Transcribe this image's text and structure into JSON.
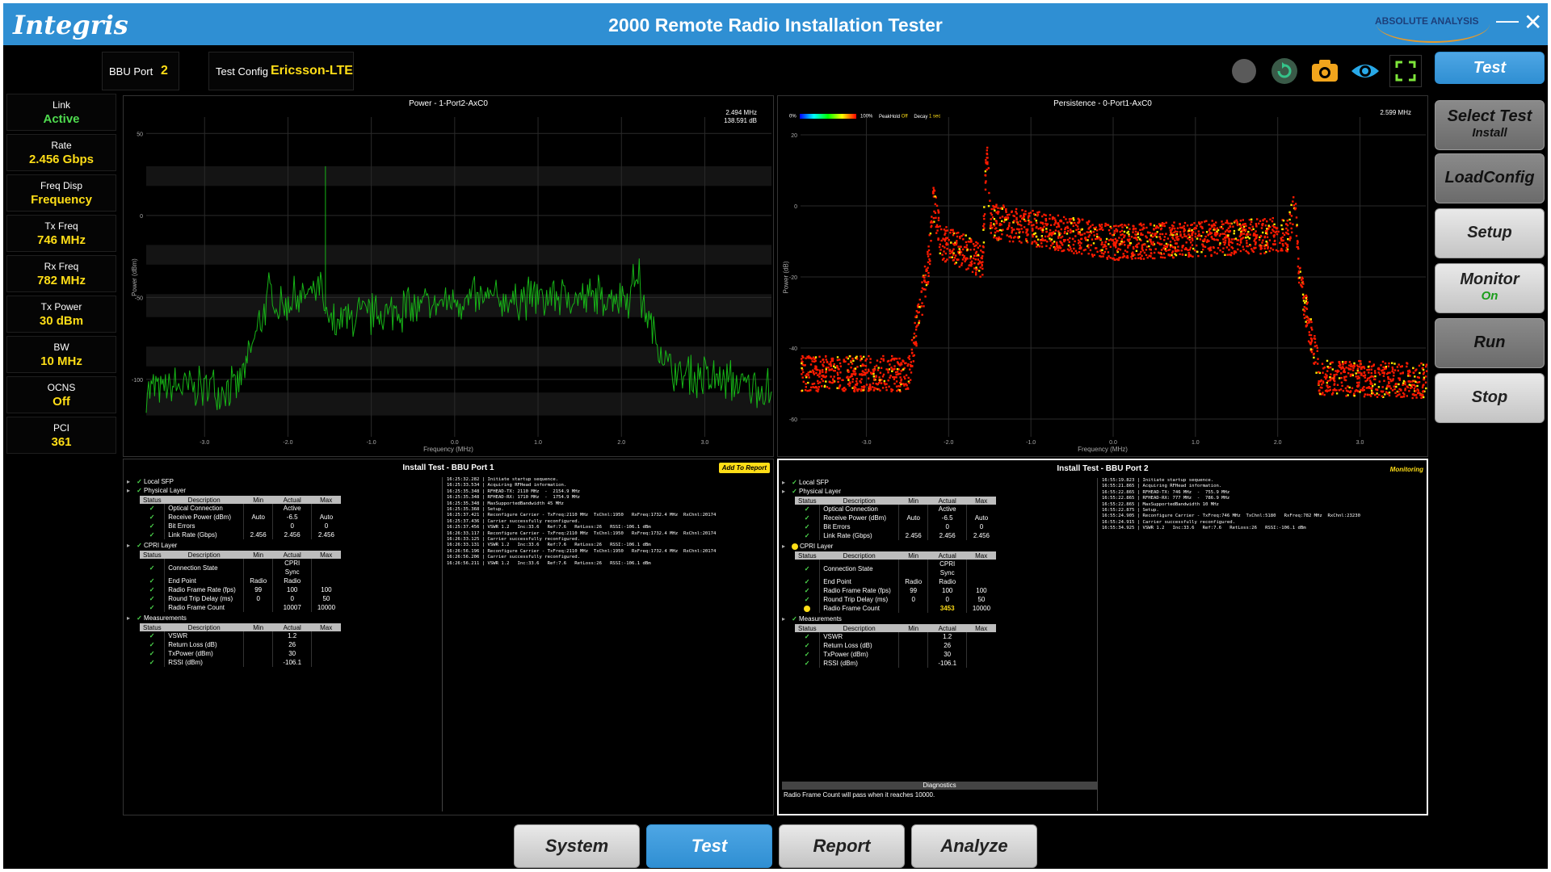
{
  "window": {
    "title": "2000 Remote Radio Installation Tester",
    "logo": "Integris",
    "brand": "ABSOLUTE ANALYSIS",
    "minimize_icon": "minimize-icon",
    "close_icon": "close-icon"
  },
  "toolbar": {
    "bbu_port_label": "BBU Port",
    "bbu_port_value": "2",
    "test_config_label": "Test Config",
    "test_config_value": "Ericsson-LTE",
    "icons": [
      "record-circle-icon",
      "refresh-icon",
      "camera-icon",
      "eye-icon",
      "fullscreen-icon"
    ]
  },
  "status": [
    {
      "label": "Link",
      "value": "Active",
      "color": "#4fdc4f"
    },
    {
      "label": "Rate",
      "value": "2.456 Gbps"
    },
    {
      "label": "Freq Disp",
      "value": "Frequency"
    },
    {
      "label": "Tx Freq",
      "value": "746 MHz"
    },
    {
      "label": "Rx Freq",
      "value": "782 MHz"
    },
    {
      "label": "Tx Power",
      "value": "30 dBm"
    },
    {
      "label": "BW",
      "value": "10 MHz"
    },
    {
      "label": "OCNS",
      "value": "Off"
    },
    {
      "label": "PCI",
      "value": "361"
    }
  ],
  "right_menu": [
    {
      "label": "Test",
      "state": "active"
    },
    {
      "label": "Select Test",
      "sub": "Install",
      "state": "dim"
    },
    {
      "label": "LoadConfig",
      "state": "dim"
    },
    {
      "label": "Setup",
      "state": "normal"
    },
    {
      "label": "Monitor",
      "sub": "On",
      "state": "normal"
    },
    {
      "label": "Run",
      "state": "dim"
    },
    {
      "label": "Stop",
      "state": "normal"
    }
  ],
  "charts": {
    "power": {
      "title": "Power - 1-Port2-AxC0",
      "readout1": "2.494 MHz",
      "readout2": "138.591 dB",
      "xlabel": "Frequency (MHz)",
      "ylabel": "Power (dBm)",
      "yticks": [
        "50",
        "0",
        "-50",
        "-100"
      ],
      "xticks": [
        "-3.0",
        "-2.0",
        "-1.0",
        "0.0",
        "1.0",
        "2.0",
        "3.0"
      ],
      "color": "#17b417"
    },
    "persistence": {
      "title": "Persistence - 0-Port1-AxC0",
      "readout1": "2.599 MHz",
      "xlabel": "Frequency (MHz)",
      "ylabel": "Power (dB)",
      "legend_left": "0%",
      "legend_right": "100%",
      "peakhold_label": "PeakHold",
      "peakhold_value": "Off",
      "decay_label": "Decay",
      "decay_value": "1 sec",
      "yticks": [
        "20",
        "0",
        "-20",
        "-40",
        "-60"
      ],
      "xticks": [
        "-3.0",
        "-2.0",
        "-1.0",
        "0.0",
        "1.0",
        "2.0",
        "3.0"
      ],
      "color": "#ff1a00"
    }
  },
  "chart_data": [
    {
      "type": "area",
      "title": "Power - 1-Port2-AxC0",
      "xlabel": "Frequency (MHz)",
      "ylabel": "Power (dBm)",
      "xlim": [
        -3.7,
        3.8
      ],
      "ylim": [
        -135,
        60
      ],
      "series": [
        {
          "x": [
            -3.7,
            -2.6,
            -2.5,
            -2.2,
            -2.15,
            -1.6,
            -1.55,
            0.0,
            2.1,
            2.2,
            2.25,
            2.6,
            3.8
          ],
          "y": [
            -102,
            -100,
            -88,
            -40,
            -52,
            -40,
            -62,
            -48,
            -45,
            -30,
            -50,
            -92,
            -102
          ]
        }
      ]
    },
    {
      "type": "scatter",
      "title": "Persistence - 0-Port1-AxC0",
      "xlabel": "Frequency (MHz)",
      "ylabel": "Power (dB)",
      "xlim": [
        -3.8,
        3.8
      ],
      "ylim": [
        -65,
        25
      ],
      "series": [
        {
          "x": [
            -3.8,
            -2.5,
            -2.25,
            -2.2,
            -2.1,
            -1.6,
            -1.55,
            -1.5,
            0.0,
            2.1,
            2.2,
            2.25,
            2.5,
            3.8
          ],
          "y": [
            -47,
            -47,
            -15,
            2,
            -10,
            -15,
            15,
            -4,
            -10,
            -8,
            1,
            -20,
            -48,
            -49
          ]
        }
      ]
    }
  ],
  "port1": {
    "title": "Install Test - BBU Port 1",
    "badge": "Add To Report",
    "badge_color": "#ffde17",
    "nodes": {
      "local_sfp": "Local SFP",
      "physical": "Physical Layer",
      "cpri": "CPRI Layer",
      "measurements": "Measurements"
    },
    "headers": [
      "Status",
      "Description",
      "Min",
      "Actual",
      "Max"
    ],
    "physical_rows": [
      [
        "Optical Connection",
        "",
        "Active",
        ""
      ],
      [
        "Receive Power (dBm)",
        "Auto",
        "-6.5",
        "Auto"
      ],
      [
        "Bit Errors",
        "",
        "0",
        "0"
      ],
      [
        "Link Rate (Gbps)",
        "2.456",
        "2.456",
        "2.456"
      ]
    ],
    "cpri_rows": [
      [
        "Connection State",
        "",
        "CPRI Sync",
        ""
      ],
      [
        "End Point",
        "Radio",
        "Radio",
        ""
      ],
      [
        "Radio Frame Rate (fps)",
        "99",
        "100",
        "100"
      ],
      [
        "Round Trip Delay (ms)",
        "0",
        "0",
        "50"
      ],
      [
        "Radio Frame Count",
        "",
        "10007",
        "10000"
      ]
    ],
    "meas_rows": [
      [
        "VSWR",
        "",
        "1.2",
        ""
      ],
      [
        "Return Loss (dB)",
        "",
        "26",
        ""
      ],
      [
        "TxPower (dBm)",
        "",
        "30",
        ""
      ],
      [
        "RSSI (dBm)",
        "",
        "-106.1",
        ""
      ]
    ],
    "log": "16:25:32.282 | Initiate startup sequence.\n16:25:33.534 | Acquiring RFHead information.\n16:25:35.348 | RFHEAD-TX: 2110 MHz  -  2154.9 MHz\n16:25:35.348 | RFHEAD-RX: 1710 MHz  -  1754.9 MHz\n16:25:35.348 | MaxSupportedBandwidth 45 MHz\n16:25:35.368 | Setup.\n16:25:37.421 | Reconfigure Carrier - TxFreq:2110 MHz  TxChnl:1950   RxFreq:1732.4 MHz  RxChnl:20174\n16:25:37.436 | Carrier successfully reconfigured.\n16:25:37.456 | VSWR 1.2   Inc:33.6   Ref:7.6   RetLoss:26   RSSI:-106.1 dBm\n16:26:33.117 | Reconfigure Carrier - TxFreq:2110 MHz  TxChnl:1950   RxFreq:1732.4 MHz  RxChnl:20174\n16:26:33.125 | Carrier successfully reconfigured.\n16:26:33.131 | VSWR 1.2   Inc:33.6   Ref:7.6   RetLoss:26   RSSI:-106.1 dBm\n16:26:56.196 | Reconfigure Carrier - TxFreq:2110 MHz  TxChnl:1950   RxFreq:1732.4 MHz  RxChnl:20174\n16:26:56.206 | Carrier successfully reconfigured.\n16:26:56.211 | VSWR 1.2   Inc:33.6   Ref:7.6   RetLoss:26   RSSI:-106.1 dBm"
  },
  "port2": {
    "title": "Install Test - BBU Port 2",
    "badge": "Monitoring",
    "badge_color": "#ffde17",
    "nodes": {
      "local_sfp": "Local SFP",
      "physical": "Physical Layer",
      "cpri": "CPRI Layer",
      "measurements": "Measurements"
    },
    "headers": [
      "Status",
      "Description",
      "Min",
      "Actual",
      "Max"
    ],
    "physical_rows": [
      [
        "Optical Connection",
        "",
        "Active",
        ""
      ],
      [
        "Receive Power (dBm)",
        "Auto",
        "-6.5",
        "Auto"
      ],
      [
        "Bit Errors",
        "",
        "0",
        "0"
      ],
      [
        "Link Rate (Gbps)",
        "2.456",
        "2.456",
        "2.456"
      ]
    ],
    "cpri_rows": [
      [
        "Connection State",
        "",
        "CPRI Sync",
        ""
      ],
      [
        "End Point",
        "Radio",
        "Radio",
        ""
      ],
      [
        "Radio Frame Rate (fps)",
        "99",
        "100",
        "100"
      ],
      [
        "Round Trip Delay (ms)",
        "0",
        "0",
        "50"
      ],
      [
        "Radio Frame Count",
        "",
        "3453",
        "10000"
      ]
    ],
    "meas_rows": [
      [
        "VSWR",
        "",
        "1.2",
        ""
      ],
      [
        "Return Loss (dB)",
        "",
        "26",
        ""
      ],
      [
        "TxPower (dBm)",
        "",
        "30",
        ""
      ],
      [
        "RSSI (dBm)",
        "",
        "-106.1",
        ""
      ]
    ],
    "pending_color": "#ffde17",
    "diagnostics_title": "Diagnostics",
    "diagnostics_text": "Radio Frame Count will pass when it reaches 10000.",
    "log": "16:55:19.823 | Initiate startup sequence.\n16:55:21.865 | Acquiring RFHead information.\n16:55:22.865 | RFHEAD-TX: 746 MHz  -  755.9 MHz\n16:55:22.865 | RFHEAD-RX: 777 MHz  -  786.9 MHz\n16:55:22.865 | MaxSupportedBandwidth 10 MHz\n16:55:22.875 | Setup.\n16:55:24.905 | Reconfigure Carrier - TxFreq:746 MHz  TxChnl:5180   RxFreq:782 MHz  RxChnl:23230\n16:55:24.915 | Carrier successfully reconfigured.\n16:55:34.925 | VSWR 1.2   Inc:33.6   Ref:7.6   RetLoss:26   RSSI:-106.1 dBm"
  },
  "bottom_tabs": [
    {
      "label": "System",
      "state": "normal"
    },
    {
      "label": "Test",
      "state": "active"
    },
    {
      "label": "Report",
      "state": "normal"
    },
    {
      "label": "Analyze",
      "state": "normal"
    }
  ]
}
